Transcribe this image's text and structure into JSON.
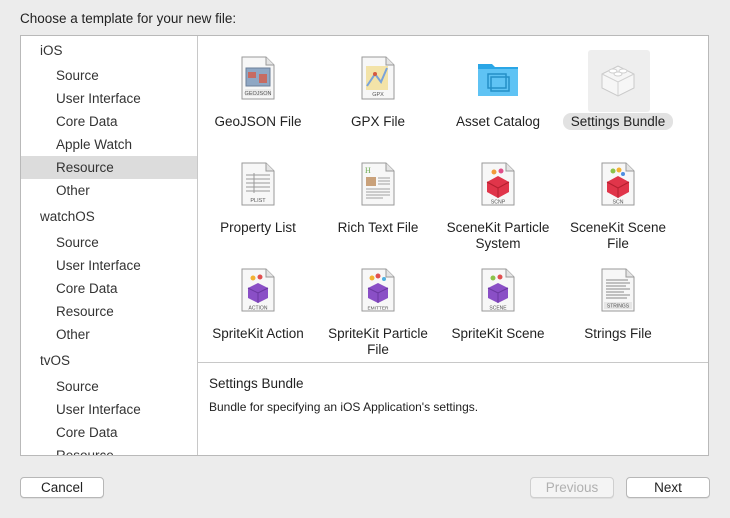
{
  "dialog": {
    "heading": "Choose a template for your new file:"
  },
  "sidebar": {
    "rows": [
      {
        "label": "iOS",
        "type": "section"
      },
      {
        "label": "Source",
        "type": "item"
      },
      {
        "label": "User Interface",
        "type": "item"
      },
      {
        "label": "Core Data",
        "type": "item"
      },
      {
        "label": "Apple Watch",
        "type": "item"
      },
      {
        "label": "Resource",
        "type": "item",
        "selected": true
      },
      {
        "label": "Other",
        "type": "item"
      },
      {
        "label": "watchOS",
        "type": "section"
      },
      {
        "label": "Source",
        "type": "item"
      },
      {
        "label": "User Interface",
        "type": "item"
      },
      {
        "label": "Core Data",
        "type": "item"
      },
      {
        "label": "Resource",
        "type": "item"
      },
      {
        "label": "Other",
        "type": "item"
      },
      {
        "label": "tvOS",
        "type": "section"
      },
      {
        "label": "Source",
        "type": "item"
      },
      {
        "label": "User Interface",
        "type": "item"
      },
      {
        "label": "Core Data",
        "type": "item"
      },
      {
        "label": "Resource",
        "type": "item"
      }
    ]
  },
  "templates": [
    {
      "label": "GeoJSON File",
      "icon": "geojson-file-icon",
      "badge": "GEOJSON"
    },
    {
      "label": "GPX File",
      "icon": "gpx-file-icon",
      "badge": "GPX"
    },
    {
      "label": "Asset Catalog",
      "icon": "folder-icon"
    },
    {
      "label": "Settings Bundle",
      "icon": "lego-brick-icon",
      "selected": true
    },
    {
      "label": "Property List",
      "icon": "plist-file-icon",
      "badge": "PLIST"
    },
    {
      "label": "Rich Text File",
      "icon": "rich-text-file-icon"
    },
    {
      "label": "SceneKit Particle System",
      "icon": "scenekit-particle-icon",
      "badge": "SCNP"
    },
    {
      "label": "SceneKit Scene File",
      "icon": "scenekit-scene-icon",
      "badge": "SCN"
    },
    {
      "label": "SpriteKit Action",
      "icon": "spritekit-action-icon",
      "badge": "ACTION"
    },
    {
      "label": "SpriteKit Particle File",
      "icon": "spritekit-particle-icon",
      "badge": "EMITTER"
    },
    {
      "label": "SpriteKit Scene",
      "icon": "spritekit-scene-icon",
      "badge": "SCENE"
    },
    {
      "label": "Strings File",
      "icon": "strings-file-icon",
      "badge": "STRINGS"
    }
  ],
  "description": {
    "title": "Settings Bundle",
    "text": "Bundle for specifying an iOS Application's settings."
  },
  "buttons": {
    "cancel": "Cancel",
    "previous": "Previous",
    "next": "Next"
  },
  "colors": {
    "selection": "#dcdcdc",
    "folder_blue": "#3bb4ef",
    "scenekit_red": "#e0354a"
  }
}
